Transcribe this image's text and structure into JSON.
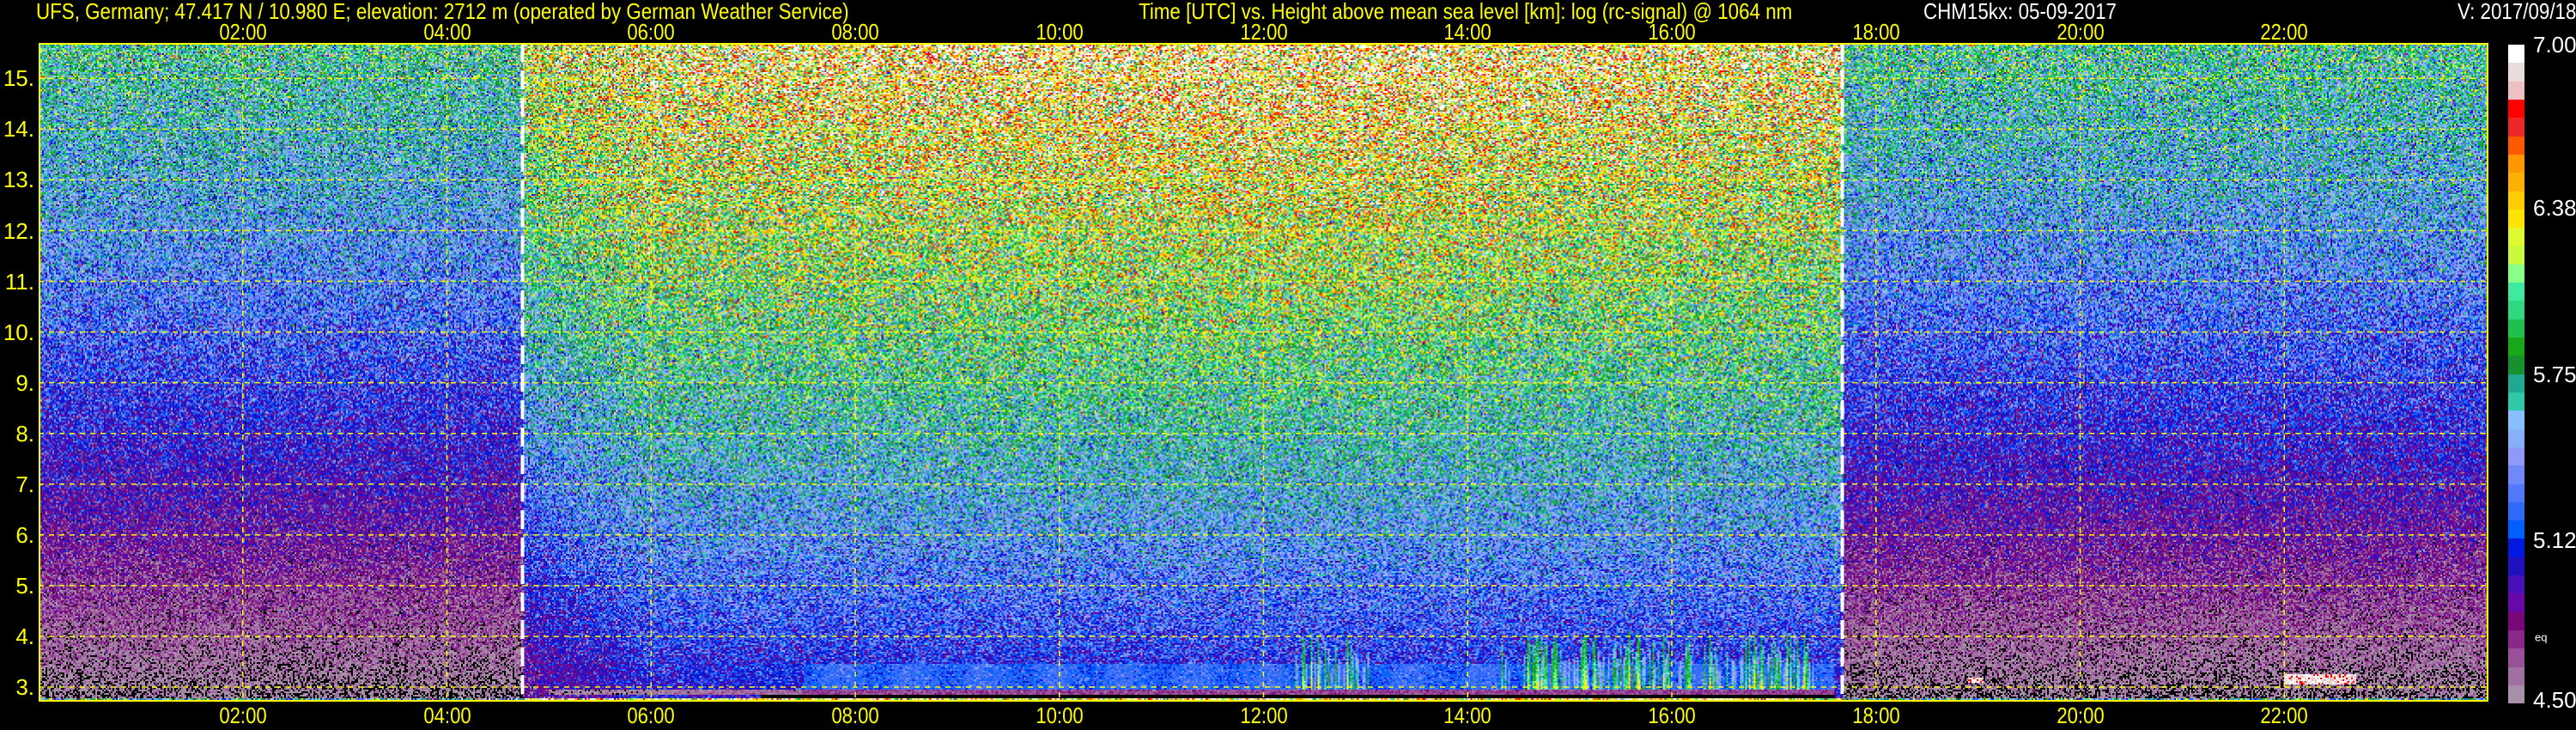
{
  "header": {
    "station": "UFS, Germany; 47.417 N / 10.980 E; elevation: 2712 m  (operated by German Weather Service)",
    "title": "Time [UTC] vs. Height above mean sea level [km]: log (rc-signal) @ 1064 nm",
    "instrument_date": "CHM15kx: 05-09-2017",
    "version": "V: 2017/09/18"
  },
  "chart_data": {
    "type": "heatmap",
    "title": "Time [UTC] vs. Height above mean sea level [km]: log (rc-signal) @ 1064 nm",
    "xlabel": "Time [UTC]",
    "ylabel": "Height above mean sea level [km]",
    "xlim": [
      0,
      24
    ],
    "ylim": [
      2.712,
      15.7
    ],
    "xticks": [
      2,
      4,
      6,
      8,
      10,
      12,
      14,
      16,
      18,
      20,
      22
    ],
    "xtick_labels": [
      "02:00",
      "04:00",
      "06:00",
      "08:00",
      "10:00",
      "12:00",
      "14:00",
      "16:00",
      "18:00",
      "20:00",
      "22:00"
    ],
    "yticks": [
      3,
      4,
      5,
      6,
      7,
      8,
      9,
      10,
      11,
      12,
      13,
      14,
      15
    ],
    "ytick_labels": [
      "3.",
      "4.",
      "5.",
      "6.",
      "7.",
      "8.",
      "9.",
      "10.",
      "11.",
      "12.",
      "13.",
      "14.",
      "15."
    ],
    "grid": true,
    "vertical_markers_utc": [
      4.74,
      17.67
    ],
    "colorbar": {
      "min": 4.5,
      "max": 7.0,
      "tick_values": [
        7.0,
        6.38,
        5.75,
        5.12,
        4.5
      ],
      "tick_labels": [
        "7.00",
        "6.38",
        "5.75",
        "5.12",
        "4.50"
      ],
      "eq_label": "eq",
      "eq_value": 4.75,
      "colors_top_to_bottom": [
        "#ffffff",
        "#e8dcdc",
        "#ecc0c4",
        "#ff0000",
        "#ee2828",
        "#ff5a00",
        "#ff9800",
        "#ffb000",
        "#ffcc00",
        "#ffe400",
        "#e0f830",
        "#c8f840",
        "#88ff88",
        "#40e8a0",
        "#30d880",
        "#20c050",
        "#18a818",
        "#189030",
        "#20a890",
        "#30c8a8",
        "#88c0ff",
        "#88b0f8",
        "#9098f8",
        "#7088f8",
        "#5078f8",
        "#3068f8",
        "#0060ff",
        "#0018e0",
        "#2010c0",
        "#4810b8",
        "#6808a8",
        "#780878",
        "#882888",
        "#985098",
        "#a070a0",
        "#a890a8"
      ]
    },
    "features": {
      "aerosol_layer": {
        "t_start": 7.5,
        "t_end": 17.6,
        "h_bottom": 2.95,
        "h_top": 3.45,
        "value": 5.2
      },
      "convective_plumes": [
        {
          "t_start": 12.3,
          "t_end": 13.1
        },
        {
          "t_start": 14.3,
          "t_end": 17.4
        }
      ],
      "plume_max_height_km": 4.1,
      "clouds": [
        {
          "t_start": 18.9,
          "t_end": 19.05,
          "h_bottom": 3.1,
          "h_top": 3.2
        },
        {
          "t_start": 22.0,
          "t_end": 22.7,
          "h_bottom": 3.05,
          "h_top": 3.25
        }
      ]
    }
  }
}
